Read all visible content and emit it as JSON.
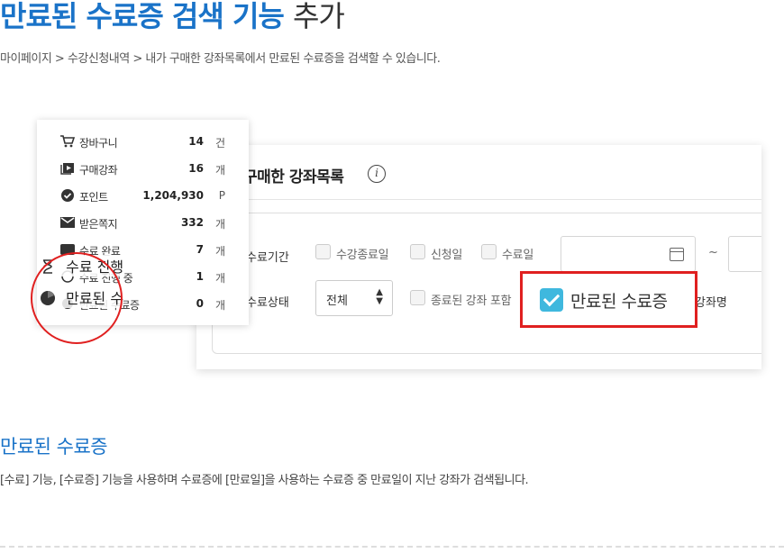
{
  "heading": {
    "highlight": "만료된 수료증 검색 기능",
    "rest": "추가"
  },
  "breadcrumb": "마이페이지 > 수강신청내역 > 내가 구매한 강좌목록에서 만료된 수료증을 검색할 수 있습니다.",
  "menu": {
    "items": [
      {
        "icon": "cart-icon",
        "label": "장바구니",
        "value": "14",
        "unit": "건"
      },
      {
        "icon": "play-icon",
        "label": "구매강좌",
        "value": "16",
        "unit": "개"
      },
      {
        "icon": "check-circle-icon",
        "label": "포인트",
        "value": "1,204,930",
        "unit": "P"
      },
      {
        "icon": "mail-icon",
        "label": "받은쪽지",
        "value": "332",
        "unit": "개"
      },
      {
        "icon": "box-icon",
        "label": "수료 완료",
        "value": "7",
        "unit": "개"
      },
      {
        "icon": "clock-icon",
        "label": "수료 진행 중",
        "value": "1",
        "unit": "개"
      },
      {
        "icon": "pie-icon",
        "label": "만료된 수료증",
        "value": "0",
        "unit": "개"
      }
    ],
    "zoom_items": [
      {
        "icon": "hourglass-icon",
        "label": "수료 진행"
      },
      {
        "icon": "pie-icon",
        "label": "만료된 수"
      }
    ]
  },
  "panel": {
    "title": "구매한 강좌목록",
    "period_label": "수료기간",
    "period_options": [
      "수강종료일",
      "신청일",
      "수료일"
    ],
    "date_from": "",
    "date_sep": "~",
    "status_label": "수료상태",
    "status_value": "전체",
    "include_ended_label": "종료된 강좌 포함",
    "expired_checkbox_label": "만료된 수료증",
    "expired_checked": true,
    "course_name_label": "강좌명"
  },
  "section": {
    "subtitle": "만료된 수료증",
    "description": "[수료] 기능, [수료증] 기능을 사용하며 수료증에 [만료일]을 사용하는 수료증 중 만료일이 지난 강좌가 검색됩니다."
  },
  "colors": {
    "accent": "#1a73c8",
    "highlight_border": "#e02020",
    "checkbox_checked": "#3fb8de"
  }
}
